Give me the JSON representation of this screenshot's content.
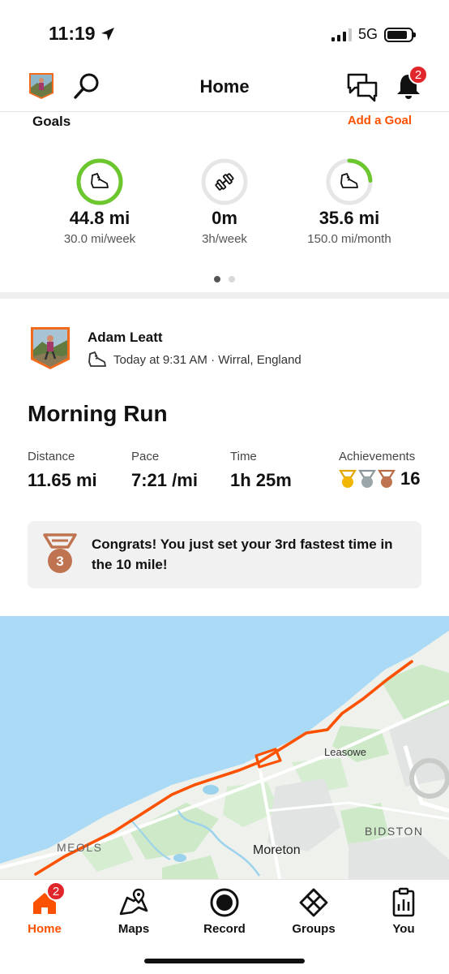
{
  "status_bar": {
    "time": "11:19",
    "network": "5G"
  },
  "header": {
    "title": "Home",
    "notification_count": "2"
  },
  "goals": {
    "title": "Goals",
    "add_label": "Add a Goal",
    "items": [
      {
        "icon": "run-shoe-icon",
        "value": "44.8 mi",
        "target": "30.0 mi/week",
        "progress": 1.0
      },
      {
        "icon": "dumbbell-icon",
        "value": "0m",
        "target": "3h/week",
        "progress": 0.0
      },
      {
        "icon": "run-shoe-icon",
        "value": "35.6 mi",
        "target": "150.0 mi/month",
        "progress": 0.24
      }
    ]
  },
  "activity": {
    "athlete": "Adam Leatt",
    "meta": "Today at 9:31 AM · Wirral, England",
    "title": "Morning Run",
    "stats": [
      {
        "label": "Distance",
        "value": "11.65 mi"
      },
      {
        "label": "Pace",
        "value": "7:21 /mi"
      },
      {
        "label": "Time",
        "value": "1h 25m"
      }
    ],
    "achievements": {
      "label": "Achievements",
      "count": "16"
    },
    "congrats": "Congrats! You just set your 3rd fastest time in the 10 mile!",
    "congrats_rank": "3"
  },
  "map": {
    "labels": [
      "Leasowe",
      "BIDSTON",
      "MEOLS",
      "Moreton"
    ]
  },
  "nav": {
    "home_badge": "2",
    "items": [
      {
        "label": "Home",
        "icon": "home-icon",
        "active": true
      },
      {
        "label": "Maps",
        "icon": "map-icon"
      },
      {
        "label": "Record",
        "icon": "record-icon"
      },
      {
        "label": "Groups",
        "icon": "groups-icon"
      },
      {
        "label": "You",
        "icon": "profile-stats-icon"
      }
    ]
  },
  "colors": {
    "accent": "#fc5200",
    "goal_ring": "#6cc72e",
    "badge": "#e0262b",
    "water": "#aadaf5",
    "land": "#eef1ec"
  }
}
